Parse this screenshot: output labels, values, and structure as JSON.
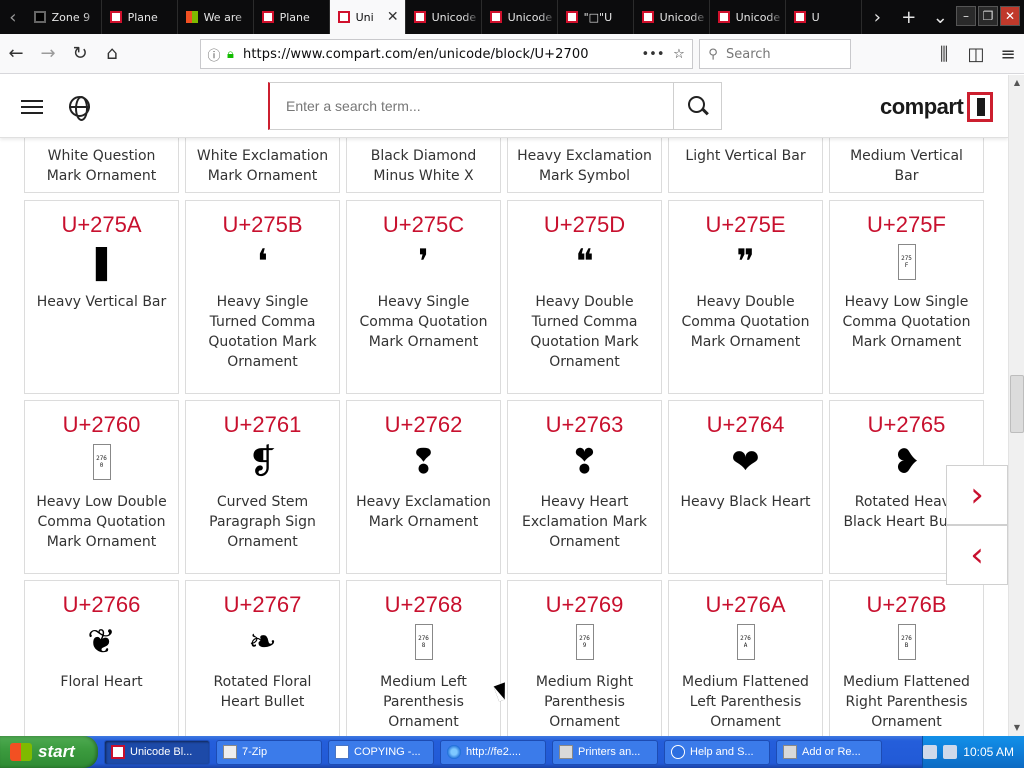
{
  "browser": {
    "tabs": [
      {
        "title": "Zone 9",
        "icon": "zone-icon"
      },
      {
        "title": "Plane",
        "icon": "unicode-favicon"
      },
      {
        "title": "We are",
        "icon": "windows-favicon"
      },
      {
        "title": "Plane",
        "icon": "unicode-favicon"
      },
      {
        "title": "Uni",
        "icon": "unicode-favicon",
        "active": true
      },
      {
        "title": "Unicode",
        "icon": "unicode-favicon"
      },
      {
        "title": "Unicode",
        "icon": "unicode-favicon"
      },
      {
        "title": "\"□\"U",
        "icon": "unicode-favicon"
      },
      {
        "title": "Unicode",
        "icon": "unicode-favicon"
      },
      {
        "title": "Unicode",
        "icon": "unicode-favicon"
      },
      {
        "title": "U",
        "icon": "unicode-favicon"
      }
    ],
    "url": "https://www.compart.com/en/unicode/block/U+2700",
    "search_placeholder": "Search"
  },
  "site": {
    "search_placeholder": "Enter a search term...",
    "logo_text": "compart"
  },
  "characters": [
    {
      "code": "",
      "glyph": "",
      "name": "White Question Mark Ornament"
    },
    {
      "code": "",
      "glyph": "",
      "name": "White Exclamation Mark Ornament"
    },
    {
      "code": "",
      "glyph": "",
      "name": "Black Diamond Minus White X"
    },
    {
      "code": "",
      "glyph": "",
      "name": "Heavy Exclamation Mark Symbol"
    },
    {
      "code": "",
      "glyph": "",
      "name": "Light Vertical Bar"
    },
    {
      "code": "",
      "glyph": "",
      "name": "Medium Vertical Bar"
    },
    {
      "code": "U+275A",
      "glyph": "❚",
      "name": "Heavy Vertical Bar"
    },
    {
      "code": "U+275B",
      "glyph": "❛",
      "name": "Heavy Single Turned Comma Quotation Mark Ornament"
    },
    {
      "code": "U+275C",
      "glyph": "❜",
      "name": "Heavy Single Comma Quotation Mark Ornament"
    },
    {
      "code": "U+275D",
      "glyph": "❝",
      "name": "Heavy Double Turned Comma Quotation Mark Ornament"
    },
    {
      "code": "U+275E",
      "glyph": "❞",
      "name": "Heavy Double Comma Quotation Mark Ornament"
    },
    {
      "code": "U+275F",
      "glyph": "",
      "box": "275F",
      "name": "Heavy Low Single Comma Quotation Mark Ornament"
    },
    {
      "code": "U+2760",
      "glyph": "",
      "box": "2760",
      "name": "Heavy Low Double Comma Quotation Mark Ornament"
    },
    {
      "code": "U+2761",
      "glyph": "❡",
      "name": "Curved Stem Paragraph Sign Ornament"
    },
    {
      "code": "U+2762",
      "glyph": "❢",
      "name": "Heavy Exclamation Mark Ornament"
    },
    {
      "code": "U+2763",
      "glyph": "❣",
      "name": "Heavy Heart Exclamation Mark Ornament"
    },
    {
      "code": "U+2764",
      "glyph": "❤",
      "name": "Heavy Black Heart"
    },
    {
      "code": "U+2765",
      "glyph": "❥",
      "name": "Rotated Heavy Black Heart Bullet"
    },
    {
      "code": "U+2766",
      "glyph": "❦",
      "name": "Floral Heart"
    },
    {
      "code": "U+2767",
      "glyph": "❧",
      "name": "Rotated Floral Heart Bullet"
    },
    {
      "code": "U+2768",
      "glyph": "",
      "box": "2768",
      "name": "Medium Left Parenthesis Ornament"
    },
    {
      "code": "U+2769",
      "glyph": "",
      "box": "2769",
      "name": "Medium Right Parenthesis Ornament"
    },
    {
      "code": "U+276A",
      "glyph": "",
      "box": "276A",
      "name": "Medium Flattened Left Parenthesis Ornament"
    },
    {
      "code": "U+276B",
      "glyph": "",
      "box": "276B",
      "name": "Medium Flattened Right Parenthesis Ornament"
    }
  ],
  "taskbar": {
    "start_label": "start",
    "items": [
      {
        "label": "Unicode Bl...",
        "icon": "unicode-favicon",
        "active": true
      },
      {
        "label": "7-Zip",
        "icon": "zip-icon"
      },
      {
        "label": "COPYING -...",
        "icon": "document-icon"
      },
      {
        "label": "http://fe2....",
        "icon": "ie-icon"
      },
      {
        "label": "Printers an...",
        "icon": "printer-icon"
      },
      {
        "label": "Help and S...",
        "icon": "help-icon"
      },
      {
        "label": "Add or Re...",
        "icon": "programs-icon"
      }
    ],
    "clock": "10:05 AM"
  },
  "colors": {
    "accent": "#c8102e",
    "taskbar": "#245edb",
    "start": "#3c9c3f"
  }
}
